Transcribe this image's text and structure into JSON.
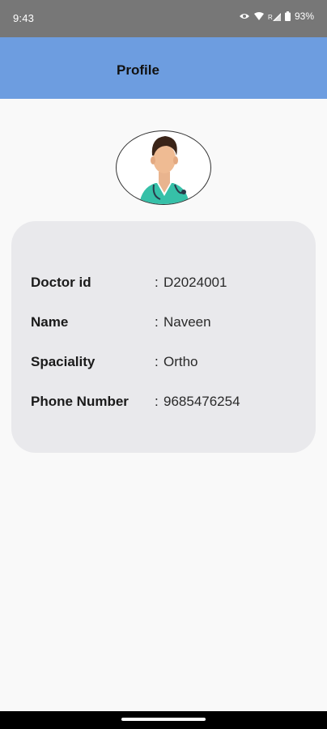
{
  "status_bar": {
    "time": "9:43",
    "battery": "93%",
    "icons": [
      "eye-icon",
      "wifi-icon",
      "signal-icon",
      "battery-icon"
    ]
  },
  "app_bar": {
    "title": "Profile",
    "background": "#6d9de0"
  },
  "avatar": {
    "icon": "doctor-avatar-icon"
  },
  "profile": {
    "rows": [
      {
        "label": "Doctor id",
        "sep": ":",
        "value": "D2024001"
      },
      {
        "label": "Name",
        "sep": ":",
        "value": "Naveen"
      },
      {
        "label": "Spaciality",
        "sep": ":",
        "value": "Ortho"
      },
      {
        "label": "Phone Number",
        "sep": ":",
        "value": "9685476254"
      }
    ]
  },
  "colors": {
    "status_bar": "#777777",
    "card": "#e9e9ec",
    "page": "#f9f9f9"
  }
}
